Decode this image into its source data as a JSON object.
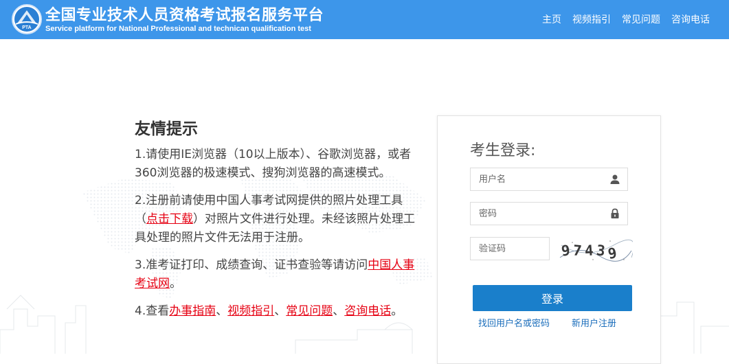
{
  "header": {
    "logo_text": "PTA",
    "title": "全国专业技术人员资格考试报名服务平台",
    "subtitle": "Service platform for National Professional and technican qualification test",
    "nav": [
      "主页",
      "视频指引",
      "常见问题",
      "咨询电话"
    ]
  },
  "notice": {
    "title": "友情提示",
    "item1": "1.请使用IE浏览器（10以上版本）、谷歌浏览器，或者360浏览器的极速模式、搜狗浏览器的高速模式。",
    "item2_a": "2.注册前请使用中国人事考试网提供的照片处理工具（",
    "item2_link": "点击下载",
    "item2_b": "）对照片文件进行处理。未经该照片处理工具处理的照片文件无法用于注册。",
    "item3_a": "3.准考证打印、成绩查询、证书查验等请访问",
    "item3_link": "中国人事考试网",
    "item3_b": "。",
    "item4_a": "4.查看",
    "item4_links": [
      "办事指南",
      "视频指引",
      "常见问题",
      "咨询电话"
    ],
    "item4_sep": "、",
    "item4_end": "。"
  },
  "login": {
    "title": "考生登录:",
    "username_placeholder": "用户名",
    "password_placeholder": "密码",
    "captcha_placeholder": "验证码",
    "captcha_chars": [
      "9",
      "7",
      "4",
      "3",
      "9"
    ],
    "login_label": "登录",
    "forgot_label": "找回用户名或密码",
    "register_label": "新用户注册"
  },
  "colors": {
    "header": "#3d96ea",
    "button": "#1a7fcb",
    "link_red": "#e60012",
    "link_blue": "#1a6dbb"
  }
}
